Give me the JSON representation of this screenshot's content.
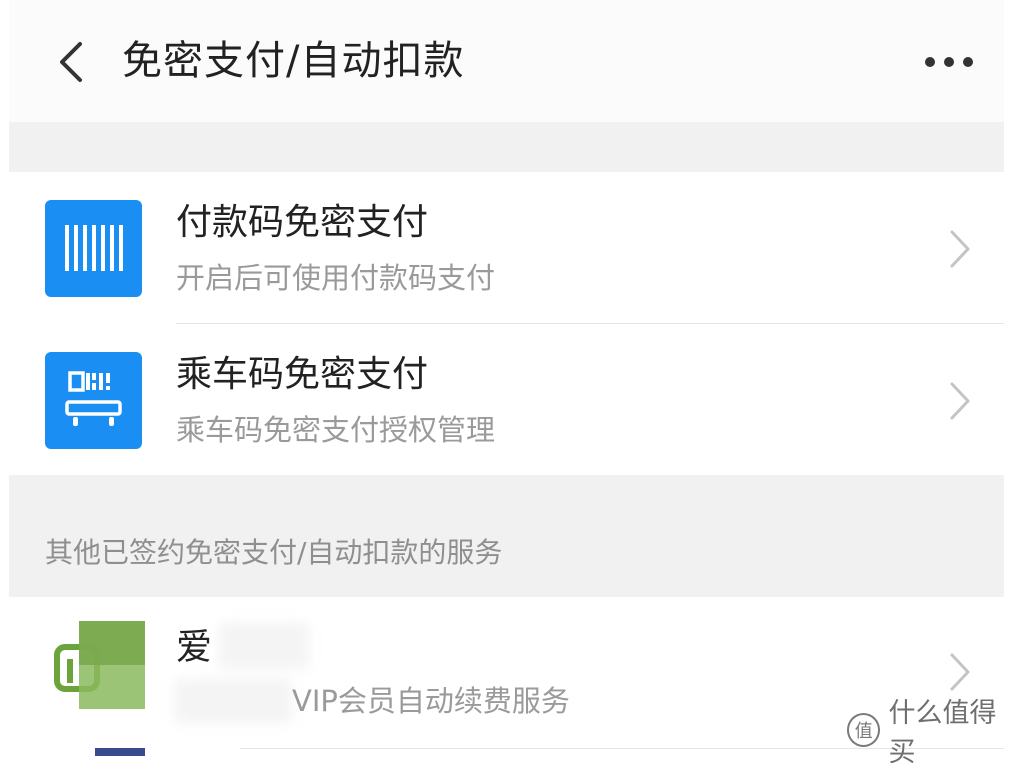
{
  "nav": {
    "title": "免密支付/自动扣款"
  },
  "services": [
    {
      "title": "付款码免密支付",
      "subtitle": "开启后可使用付款码支付"
    },
    {
      "title": "乘车码免密支付",
      "subtitle": "乘车码免密支付授权管理"
    }
  ],
  "section": {
    "label": "其他已签约免密支付/自动扣款的服务"
  },
  "others": [
    {
      "title": "爱",
      "subtitle": "VIP会员自动续费服务"
    }
  ],
  "watermark": {
    "icon_text": "值",
    "text": "什么值得买"
  },
  "colors": {
    "accent": "#1a8ef2",
    "background": "#f1f1f1",
    "iqiyi_green": "#6ca33a"
  }
}
